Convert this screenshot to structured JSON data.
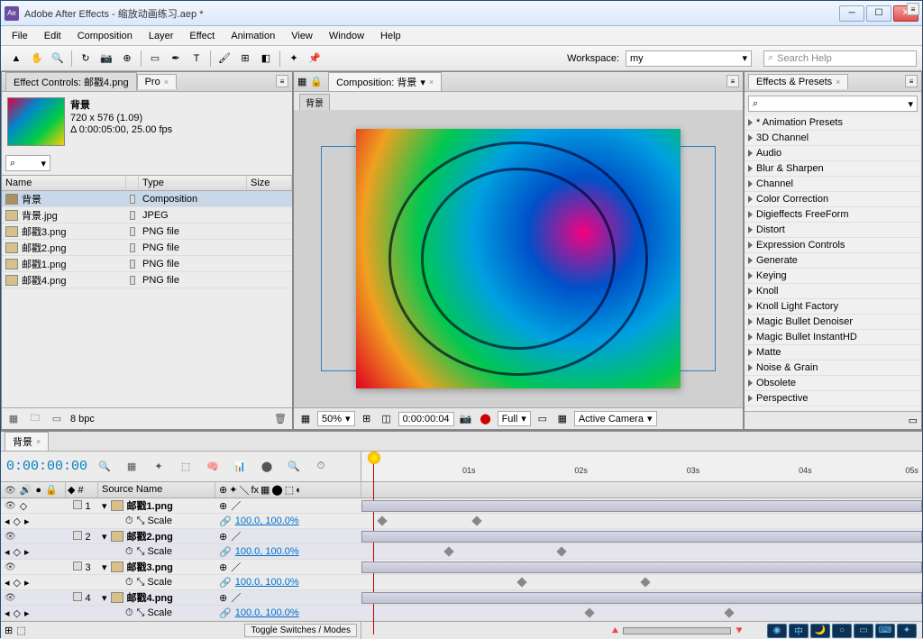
{
  "title": "Adobe After Effects - 缩放动画练习.aep *",
  "menu": [
    "File",
    "Edit",
    "Composition",
    "Layer",
    "Effect",
    "Animation",
    "View",
    "Window",
    "Help"
  ],
  "workspace": {
    "label": "Workspace:",
    "value": "my"
  },
  "search_help_placeholder": "Search Help",
  "project": {
    "tab_effect_controls": "Effect Controls: 邮戳4.png",
    "tab_project": "Pro",
    "comp_name": "背景",
    "dims": "720 x 576 (1.09)",
    "duration": "Δ 0:00:05:00, 25.00 fps",
    "search": "⌕",
    "cols": {
      "name": "Name",
      "type": "Type",
      "size": "Size"
    },
    "rows": [
      {
        "name": "背景",
        "type": "Composition"
      },
      {
        "name": "背景.jpg",
        "type": "JPEG"
      },
      {
        "name": "邮戳3.png",
        "type": "PNG file"
      },
      {
        "name": "邮戳2.png",
        "type": "PNG file"
      },
      {
        "name": "邮戳1.png",
        "type": "PNG file"
      },
      {
        "name": "邮戳4.png",
        "type": "PNG file"
      }
    ],
    "bpc": "8 bpc"
  },
  "comp": {
    "tab_label": "Composition: 背景",
    "breadcrumb": "背景",
    "zoom": "50%",
    "timecode": "0:00:00:04",
    "res": "Full",
    "view3d": "Active Camera"
  },
  "effects": {
    "tab": "Effects & Presets",
    "search": "⌕",
    "items": [
      "* Animation Presets",
      "3D Channel",
      "Audio",
      "Blur & Sharpen",
      "Channel",
      "Color Correction",
      "Digieffects FreeForm",
      "Distort",
      "Expression Controls",
      "Generate",
      "Keying",
      "Knoll",
      "Knoll Light Factory",
      "Magic Bullet Denoiser",
      "Magic Bullet InstantHD",
      "Matte",
      "Noise & Grain",
      "Obsolete",
      "Perspective"
    ]
  },
  "timeline": {
    "tab": "背景",
    "timecode": "0:00:00:00",
    "cols": {
      "source": "Source Name"
    },
    "ticks": [
      "01s",
      "02s",
      "03s",
      "04s",
      "05s"
    ],
    "layers": [
      {
        "num": "1",
        "name": "邮戳1.png"
      },
      {
        "num": "2",
        "name": "邮戳2.png"
      },
      {
        "num": "3",
        "name": "邮戳3.png"
      },
      {
        "num": "4",
        "name": "邮戳4.png"
      }
    ],
    "scale_label": "Scale",
    "scale_val": "100.0, 100.0%",
    "toggle": "Toggle Switches / Modes"
  }
}
